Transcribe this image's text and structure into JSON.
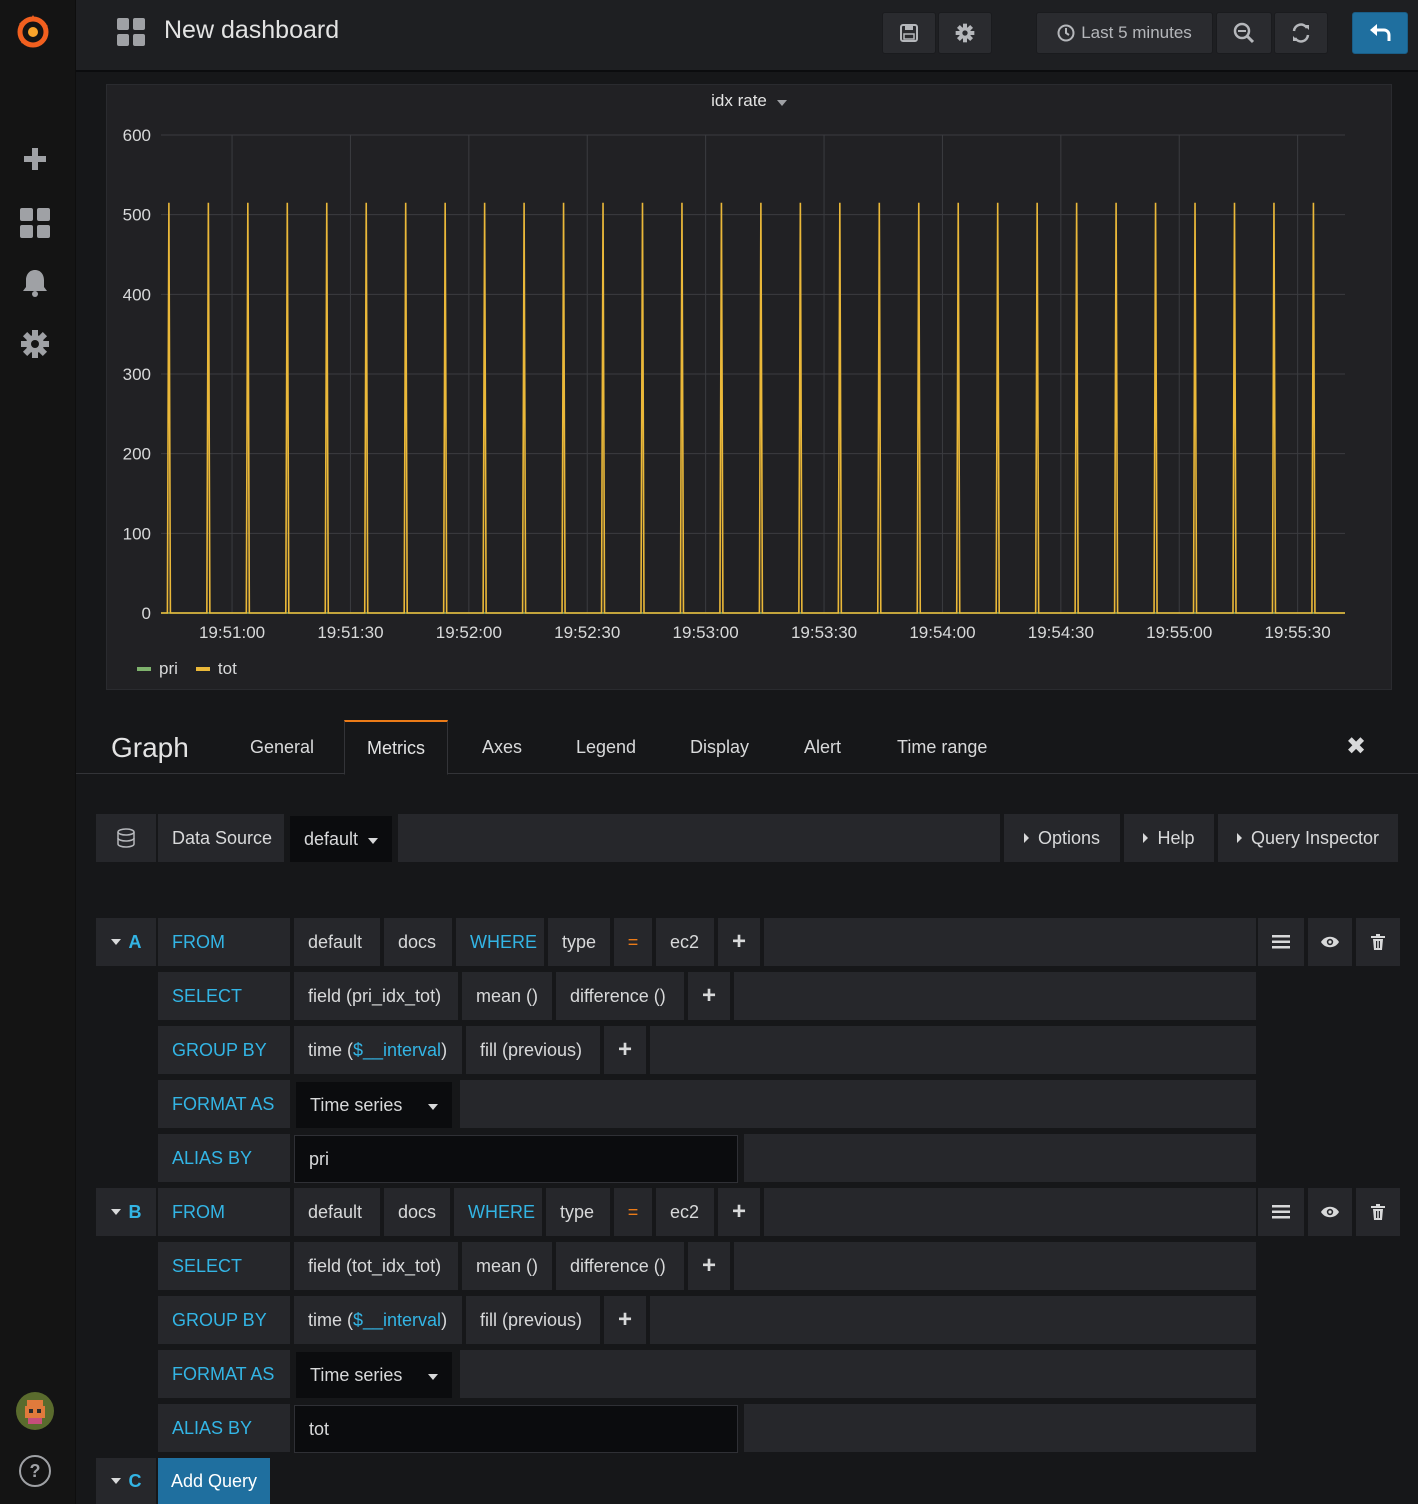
{
  "sidebar": {
    "logo": "grafana-logo",
    "items": [
      {
        "icon": "plus-icon"
      },
      {
        "icon": "dashboards-icon"
      },
      {
        "icon": "bell-icon"
      },
      {
        "icon": "gear-icon"
      }
    ],
    "bottom": [
      {
        "icon": "user-avatar"
      },
      {
        "icon": "help-icon",
        "label": "?"
      }
    ]
  },
  "navbar": {
    "title": "New dashboard",
    "time_range": "Last 5 minutes",
    "buttons": [
      "save-icon",
      "gear-icon",
      "clock-icon",
      "zoom-out-icon",
      "refresh-icon",
      "back-icon"
    ]
  },
  "panel": {
    "title": "idx rate"
  },
  "chart_data": {
    "type": "line",
    "title": "idx rate",
    "ylim": [
      0,
      600
    ],
    "y_ticks": [
      "0",
      "100",
      "200",
      "300",
      "400",
      "500",
      "600"
    ],
    "x_ticks": [
      "19:51:00",
      "19:51:30",
      "19:52:00",
      "19:52:30",
      "19:53:00",
      "19:53:30",
      "19:54:00",
      "19:54:30",
      "19:55:00",
      "19:55:30"
    ],
    "x_start": "19:50:42",
    "x_end": "19:55:42",
    "grid": true,
    "legend_placement": "bottom-left",
    "series": [
      {
        "name": "pri",
        "color": "#7eb26d",
        "spike_times": [],
        "baseline": 0
      },
      {
        "name": "tot",
        "color": "#eab839",
        "baseline": 0,
        "peak": 515,
        "spike_times": [
          "19:50:44",
          "19:50:54",
          "19:51:04",
          "19:51:14",
          "19:51:24",
          "19:51:34",
          "19:51:44",
          "19:51:54",
          "19:52:04",
          "19:52:14",
          "19:52:24",
          "19:52:34",
          "19:52:44",
          "19:52:54",
          "19:53:04",
          "19:53:14",
          "19:53:24",
          "19:53:34",
          "19:53:44",
          "19:53:54",
          "19:54:04",
          "19:54:14",
          "19:54:24",
          "19:54:34",
          "19:54:44",
          "19:54:54",
          "19:55:04",
          "19:55:14",
          "19:55:24",
          "19:55:34"
        ]
      }
    ]
  },
  "editor": {
    "title": "Graph",
    "tabs": [
      "General",
      "Metrics",
      "Axes",
      "Legend",
      "Display",
      "Alert",
      "Time range"
    ],
    "active_tab": "Metrics",
    "close": "✖"
  },
  "datasource": {
    "label": "Data Source",
    "value": "default",
    "options_label": "Options",
    "help_label": "Help",
    "inspector_label": "Query Inspector"
  },
  "queries": [
    {
      "letter": "A",
      "from_label": "FROM",
      "policy": "default",
      "measurement": "docs",
      "where_label": "WHERE",
      "tag_key": "type",
      "operator": "=",
      "tag_value": "ec2",
      "select_label": "SELECT",
      "field": "field (pri_idx_tot)",
      "agg": "mean ()",
      "transform": "difference ()",
      "group_label": "GROUP BY",
      "group_time_prefix": "time (",
      "group_time_var": "$__interval",
      "group_time_suffix": ")",
      "fill": "fill (previous)",
      "format_label": "FORMAT AS",
      "format_value": "Time series",
      "alias_label": "ALIAS BY",
      "alias_value": "pri"
    },
    {
      "letter": "B",
      "from_label": "FROM",
      "policy": "default",
      "measurement": "docs",
      "where_label": "WHERE",
      "tag_key": "type",
      "operator": "=",
      "tag_value": "ec2",
      "select_label": "SELECT",
      "field": "field (tot_idx_tot)",
      "agg": "mean ()",
      "transform": "difference ()",
      "group_label": "GROUP BY",
      "group_time_prefix": "time (",
      "group_time_var": "$__interval",
      "group_time_suffix": ")",
      "fill": "fill (previous)",
      "format_label": "FORMAT AS",
      "format_value": "Time series",
      "alias_label": "ALIAS BY",
      "alias_value": "tot"
    }
  ],
  "add_query": {
    "letter": "C",
    "label": "Add Query"
  },
  "plus": "+"
}
